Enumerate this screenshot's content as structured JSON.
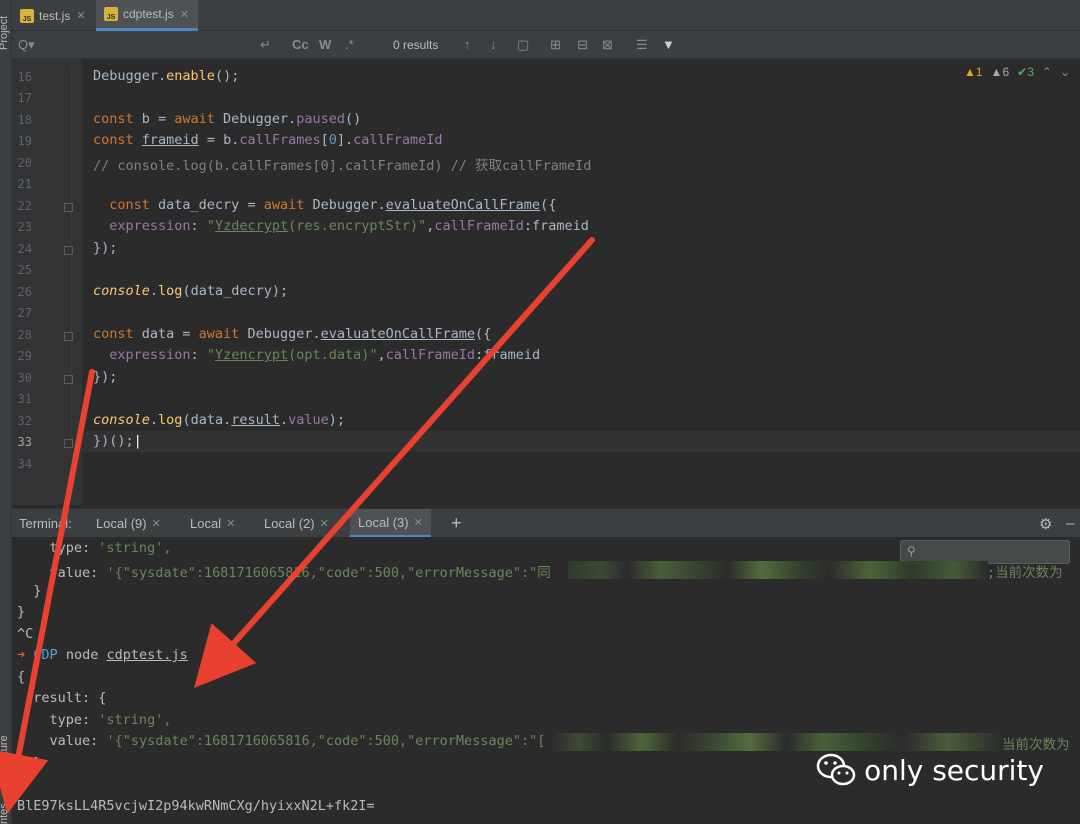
{
  "left_strip": {
    "project_label": "Project",
    "structure_label": "Structure",
    "favorites_label": "rites"
  },
  "tabs": [
    {
      "label": "test.js",
      "active": false
    },
    {
      "label": "cdptest.js",
      "active": true
    }
  ],
  "find": {
    "placeholder": "Q▾",
    "match_case": "Cc",
    "words": "W",
    "regex": ".*",
    "results": "0 results"
  },
  "inspections": {
    "errors": "1",
    "warnings": "6",
    "ok": "3"
  },
  "editor": {
    "line_numbers": [
      "16",
      "17",
      "18",
      "19",
      "20",
      "21",
      "22",
      "23",
      "24",
      "25",
      "26",
      "27",
      "28",
      "29",
      "30",
      "31",
      "32",
      "33",
      "34"
    ],
    "top_fragment": "Debugger.enable();"
  },
  "terminal": {
    "title": "Terminal:",
    "tabs": [
      "Local (9)",
      "Local",
      "Local (2)",
      "Local (3)"
    ],
    "add": "+",
    "prompt_dir": "CDP",
    "command": "node",
    "file": "cdptest.js",
    "output_last": "BlE97ksLL4R5vcjwI2p94kwRNmCXg/hyixxN2L+fk2I=",
    "type_key": "type:",
    "type_val": "'string',",
    "value_key": "value:",
    "value1": "'{\"sysdate\":1681716065816,\"code\":500,\"errorMessage\":\"同",
    "value1_tail": ";当前次数为",
    "value2": "'{\"sysdate\":1681716065816,\"code\":500,\"errorMessage\":\"[",
    "value2_tail": "当前次数为",
    "result_key": "result: {",
    "ctrl_c": "^C"
  },
  "watermark": {
    "text": "only security"
  },
  "colors": {
    "arrow": "#e8412f",
    "bg": "#2b2b2b"
  }
}
